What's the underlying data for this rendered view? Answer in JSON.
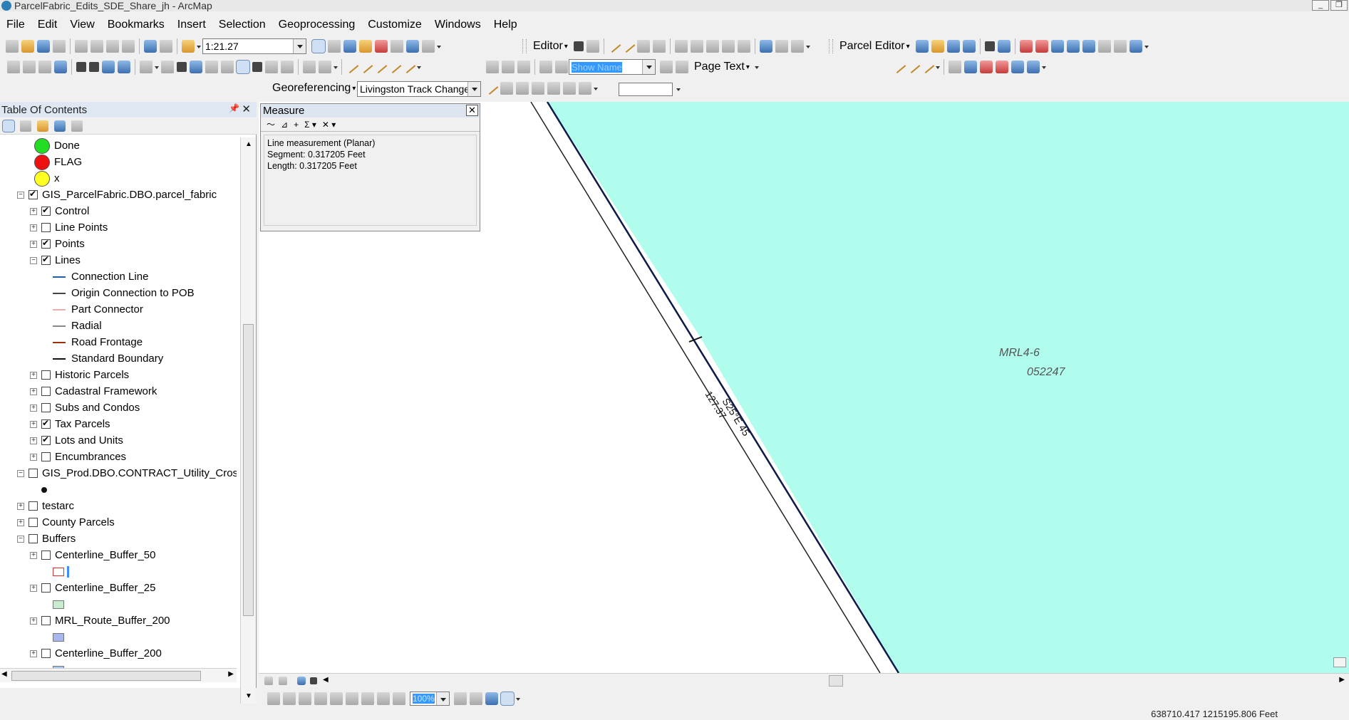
{
  "window": {
    "title": "ParcelFabric_Edits_SDE_Share_jh - ArcMap"
  },
  "menu": [
    "File",
    "Edit",
    "View",
    "Bookmarks",
    "Insert",
    "Selection",
    "Geoprocessing",
    "Customize",
    "Windows",
    "Help"
  ],
  "toolbar": {
    "scale_value": "1:21.27",
    "editor_label": "Editor",
    "parcel_editor_label": "Parcel Editor",
    "show_name_placeholder": "Show Name",
    "page_text_label": "Page Text",
    "georeferencing_label": "Georeferencing",
    "layer_combo_value": "Livingston Track Changes",
    "zoom_percent": "100%"
  },
  "toc": {
    "title": "Table Of Contents",
    "items": [
      {
        "label": "Done",
        "kind": "symbol",
        "color": "#22dd22"
      },
      {
        "label": "FLAG",
        "kind": "symbol",
        "color": "#ee1111"
      },
      {
        "label": "x",
        "kind": "symbol",
        "color": "#ffff22"
      },
      {
        "label": "GIS_ParcelFabric.DBO.parcel_fabric",
        "kind": "group",
        "checked": true,
        "expanded": true
      },
      {
        "label": "Control",
        "kind": "layer",
        "checked": true
      },
      {
        "label": "Line Points",
        "kind": "layer",
        "checked": false
      },
      {
        "label": "Points",
        "kind": "layer",
        "checked": true
      },
      {
        "label": "Lines",
        "kind": "layer",
        "checked": true,
        "expanded": true
      },
      {
        "label": "Connection Line",
        "kind": "legend",
        "line_color": "#1e5faa"
      },
      {
        "label": "Origin Connection to POB",
        "kind": "legend",
        "line_color": "#444444"
      },
      {
        "label": "Part Connector",
        "kind": "legend",
        "line_color": "#e8b0b0"
      },
      {
        "label": "Radial",
        "kind": "legend",
        "line_color": "#888888"
      },
      {
        "label": "Road Frontage",
        "kind": "legend",
        "line_color": "#a0300a"
      },
      {
        "label": "Standard Boundary",
        "kind": "legend",
        "line_color": "#111111"
      },
      {
        "label": "Historic Parcels",
        "kind": "layer",
        "checked": false
      },
      {
        "label": "Cadastral Framework",
        "kind": "layer",
        "checked": false
      },
      {
        "label": "Subs and Condos",
        "kind": "layer",
        "checked": false
      },
      {
        "label": "Tax Parcels",
        "kind": "layer",
        "checked": true
      },
      {
        "label": "Lots and Units",
        "kind": "layer",
        "checked": true
      },
      {
        "label": "Encumbrances",
        "kind": "layer",
        "checked": false
      },
      {
        "label": "GIS_Prod.DBO.CONTRACT_Utility_Crossing",
        "kind": "group",
        "checked": false,
        "expanded": true
      },
      {
        "label": "testarc",
        "kind": "group",
        "checked": false,
        "expanded": false
      },
      {
        "label": "County Parcels",
        "kind": "group",
        "checked": false,
        "expanded": false
      },
      {
        "label": "Buffers",
        "kind": "group",
        "checked": false,
        "expanded": true
      },
      {
        "label": "Centerline_Buffer_50",
        "kind": "layer",
        "checked": false
      },
      {
        "label": "Centerline_Buffer_25",
        "kind": "layer",
        "checked": false
      },
      {
        "label": "MRL_Route_Buffer_200",
        "kind": "layer",
        "checked": false
      },
      {
        "label": "Centerline_Buffer_200",
        "kind": "layer",
        "checked": false
      }
    ],
    "buffer_colors": [
      "#ffffff",
      "#c8ecd0",
      "#a8b8ee",
      "#a8c8ee"
    ]
  },
  "measure": {
    "title": "Measure",
    "lines": [
      "Line measurement (Planar)",
      "Segment: 0.317205 Feet",
      "Length: 0.317205 Feet"
    ]
  },
  "map": {
    "parcel_fill": "#b0fdee",
    "parcel_label": "MRL4-6",
    "parcel_number": "052247",
    "dim_label_1": "S25°E 45",
    "dim_label_2": "127.37"
  },
  "status": {
    "coordinates": "638710.417  1215195.806 Feet"
  }
}
